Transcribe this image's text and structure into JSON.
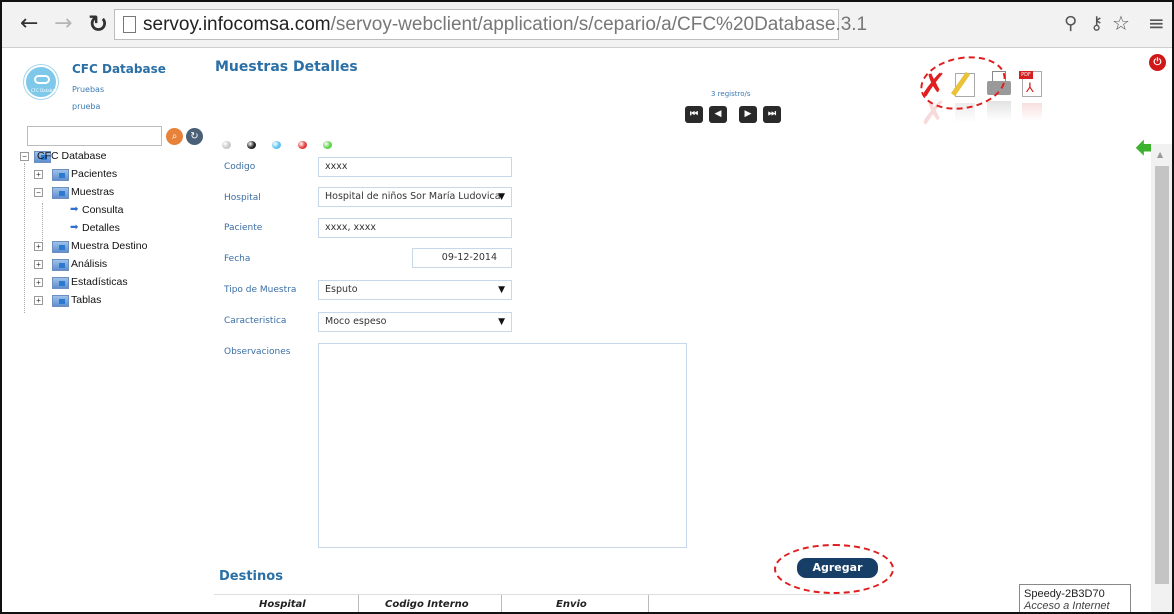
{
  "browser": {
    "url_host": "servoy.infocomsa.com",
    "url_path": "/servoy-webclient/application/s/cepario/a/CFC%20Database.3.1"
  },
  "app": {
    "title": "CFC Database",
    "subtitle1": "Pruebas",
    "subtitle2": "prueba",
    "logo_caption": "CFC Database"
  },
  "tree": [
    {
      "label": "CFC Database",
      "expander": "−",
      "kind": "folder"
    },
    {
      "label": "Pacientes",
      "expander": "+",
      "kind": "folder"
    },
    {
      "label": "Muestras",
      "expander": "−",
      "kind": "folder"
    },
    {
      "label": "Consulta",
      "kind": "leaf"
    },
    {
      "label": "Detalles",
      "kind": "leaf"
    },
    {
      "label": "Muestra Destino",
      "expander": "+",
      "kind": "folder"
    },
    {
      "label": "Análisis",
      "expander": "+",
      "kind": "folder"
    },
    {
      "label": "Estadísticas",
      "expander": "+",
      "kind": "folder"
    },
    {
      "label": "Tablas",
      "expander": "+",
      "kind": "folder"
    }
  ],
  "page": {
    "title": "Muestras Detalles",
    "color_dots": [
      "#c8c8c8",
      "#222222",
      "#5cc3ef",
      "#e23a3a",
      "#5fd24a"
    ],
    "record_count": "3 registro/s",
    "nav_buttons": [
      "first",
      "prev",
      "next",
      "last"
    ]
  },
  "form": {
    "codigo_label": "Codigo",
    "codigo_value": "xxxx",
    "hospital_label": "Hospital",
    "hospital_value": "Hospital de niños Sor María Ludovica",
    "paciente_label": "Paciente",
    "paciente_value": "xxxx, xxxx",
    "fecha_label": "Fecha",
    "fecha_value": "09-12-2014",
    "tipo_label": "Tipo de Muestra",
    "tipo_value": "Esputo",
    "caracteristica_label": "Caracteristica",
    "caracteristica_value": "Moco espeso",
    "observaciones_label": "Observaciones"
  },
  "destinos": {
    "title": "Destinos",
    "add_label": "Agregar",
    "columns": [
      "Hospital",
      "Codigo Interno",
      "Envio"
    ]
  },
  "tooltip": {
    "line1": "Speedy-2B3D70",
    "line2": "Acceso a Internet"
  },
  "colors": {
    "accent": "#2a6fa5",
    "annotation": "#e01c1c",
    "add_button": "#173e66"
  }
}
